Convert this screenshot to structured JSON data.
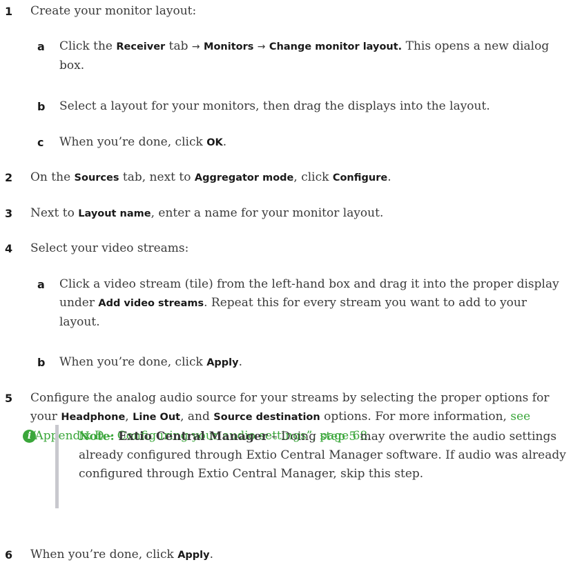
{
  "steps": {
    "s1": {
      "num": "1",
      "text": "Create your monitor layout:"
    },
    "s1a": {
      "num": "a",
      "t1": "Click the ",
      "b1": "Receiver",
      "t2": " tab ",
      "arrow": "→",
      "b2": "Monitors",
      "b3": "Change monitor layout.",
      "t3": " This opens a new dialog box."
    },
    "s1b": {
      "num": "b",
      "text": "Select a layout for your monitors, then drag the displays into the layout."
    },
    "s1c": {
      "num": "c",
      "t1": "When you’re done, click ",
      "b1": "OK",
      "t2": "."
    },
    "s2": {
      "num": "2",
      "t1": "On the ",
      "b1": "Sources",
      "t2": " tab, next to ",
      "b2": "Aggregator mode",
      "t3": ", click ",
      "b3": "Configure",
      "t4": "."
    },
    "s3": {
      "num": "3",
      "t1": "Next to ",
      "b1": "Layout name",
      "t2": ", enter a name for your monitor layout."
    },
    "s4": {
      "num": "4",
      "text": "Select your video streams:"
    },
    "s4a": {
      "num": "a",
      "t1": "Click a video stream (tile) from the left-hand box and drag it into the proper display under ",
      "b1": "Add video streams",
      "t2": ". Repeat this for every stream you want to add to your layout."
    },
    "s4b": {
      "num": "b",
      "t1": "When you’re done, click ",
      "b1": "Apply",
      "t2": "."
    },
    "s5": {
      "num": "5",
      "t1": "Configure the analog audio source for your streams by selecting the proper options for your ",
      "b1": "Headphone",
      "t2": ", ",
      "b2": "Line Out",
      "t3": ", and ",
      "b3": "Source destination",
      "t4": " options. For more information, ",
      "link": "see “Appendix D – Configuring your audio settings”, page 68",
      "t5": "."
    },
    "s6": {
      "num": "6",
      "t1": "When you’re done, click ",
      "b1": "Apply",
      "t2": "."
    }
  },
  "note": {
    "icon": "i",
    "label": "Note:",
    "title": "Extio Central Manager",
    "dash": " – Doing ",
    "link": "step 5",
    "text": " may overwrite the audio settings already configured through Extio Central Manager software. If audio was already configured through Extio Central Manager, skip this step."
  },
  "colors": {
    "link": "#3aa63a",
    "note_bar": "#c8c8ce",
    "text": "#3a3a3a"
  },
  "icons": {
    "note": "info-icon"
  }
}
